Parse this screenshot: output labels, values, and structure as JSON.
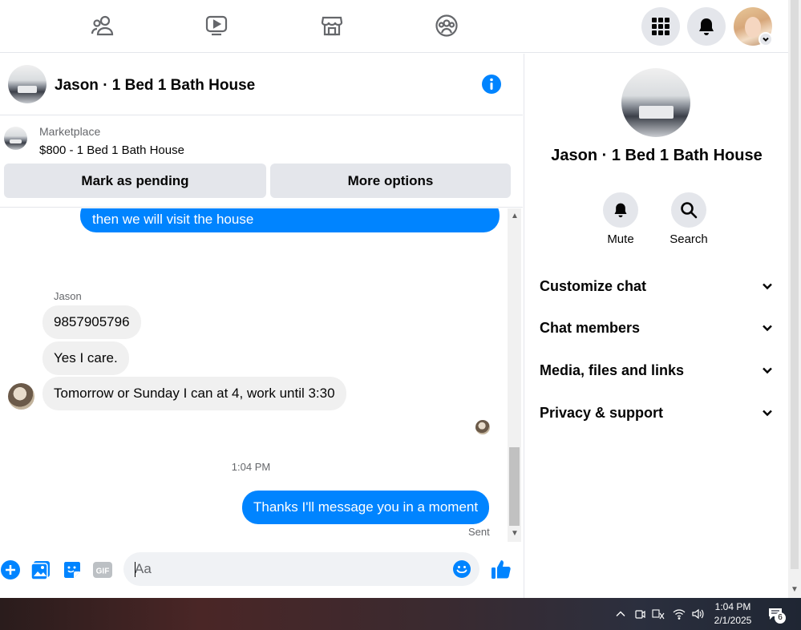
{
  "topnav": {
    "icons": [
      "friends-icon",
      "watch-icon",
      "marketplace-icon",
      "groups-icon",
      "menu-grid-icon",
      "bell-icon"
    ]
  },
  "chat": {
    "title": "Jason · 1 Bed 1 Bath House",
    "marketplace_label": "Marketplace",
    "listing": "$800 - 1 Bed 1 Bath House",
    "mark_pending": "Mark as pending",
    "more_options": "More options"
  },
  "messages": {
    "outgoing_prev": "then we will visit the house",
    "sender_name": "Jason",
    "incoming": [
      "9857905796",
      "Yes I care.",
      "Tomorrow or Sunday I can at 4, work until 3:30"
    ],
    "timestamp": "1:04 PM",
    "outgoing_last": "Thanks I'll message you in a moment",
    "status": "Sent"
  },
  "composer": {
    "placeholder": "Aa"
  },
  "panel": {
    "title": "Jason · 1 Bed 1 Bath House",
    "mute": "Mute",
    "search": "Search",
    "sections": [
      "Customize chat",
      "Chat members",
      "Media, files and links",
      "Privacy & support"
    ]
  },
  "taskbar": {
    "time": "1:04 PM",
    "date": "2/1/2025",
    "notifications": "6"
  },
  "colors": {
    "accent": "#0084ff",
    "bubble_in": "#f0f0f0",
    "button_bg": "#e4e6eb"
  }
}
